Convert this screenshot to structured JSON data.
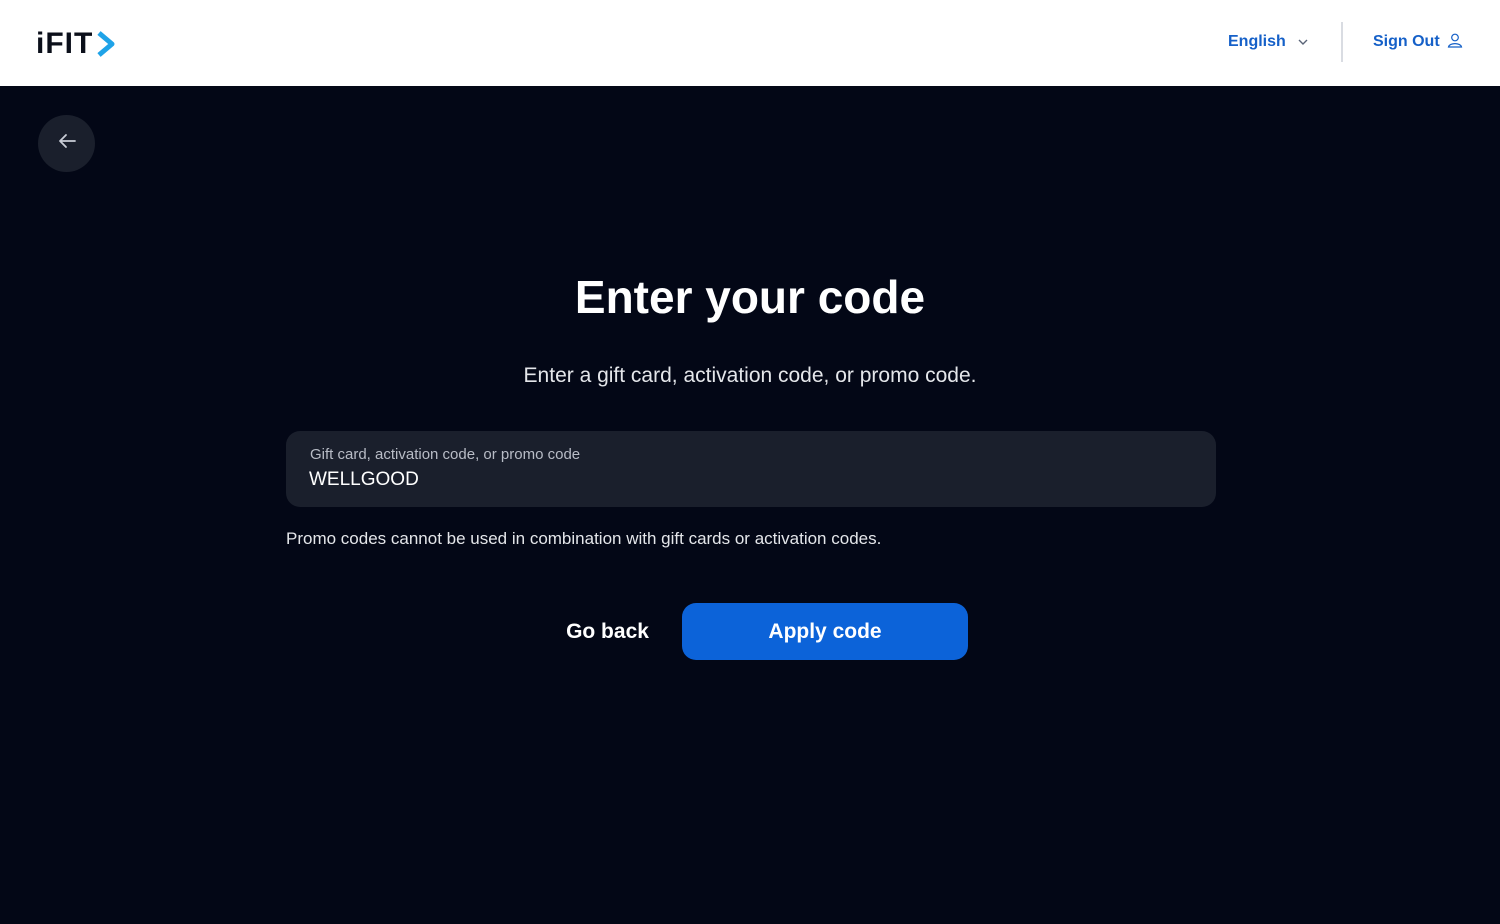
{
  "header": {
    "logo_text": "iFIT",
    "language_label": "English",
    "sign_out_label": "Sign Out"
  },
  "main": {
    "title": "Enter your code",
    "subtitle": "Enter a gift card, activation code, or promo code.",
    "field": {
      "label": "Gift card, activation code, or promo code",
      "value": "WELLGOOD"
    },
    "note": "Promo codes cannot be used in combination with gift cards or activation codes.",
    "go_back_label": "Go back",
    "apply_label": "Apply code"
  },
  "colors": {
    "background": "#030716",
    "header_bg": "#ffffff",
    "accent": "#0c63d9",
    "link": "#1560c8",
    "field_bg": "#1a1f2c"
  },
  "icons": [
    "ifit-chevron-icon",
    "chevron-down-icon",
    "user-icon",
    "arrow-left-icon"
  ]
}
